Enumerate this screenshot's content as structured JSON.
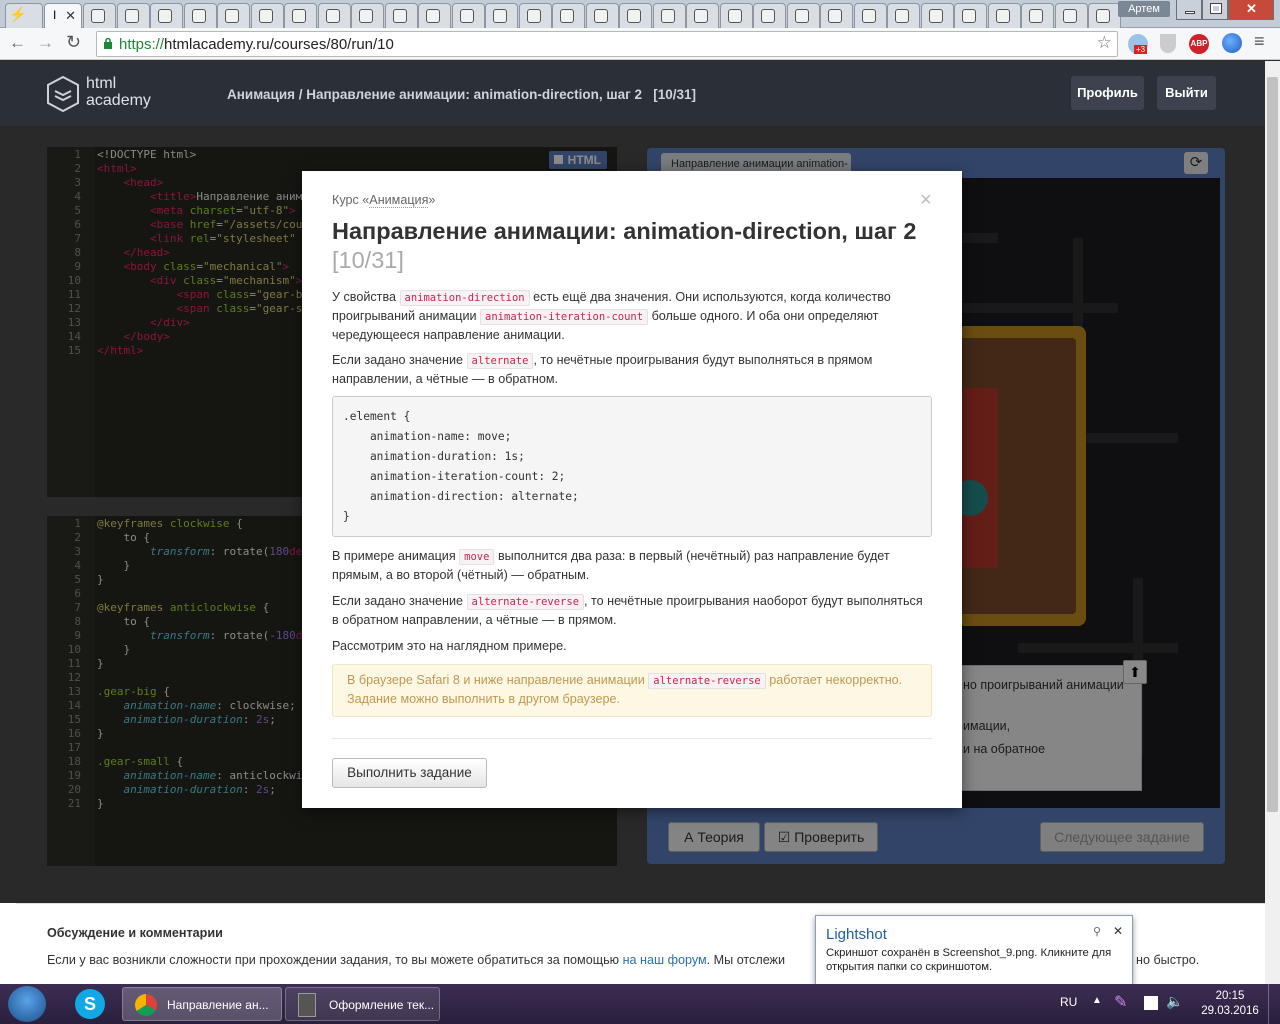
{
  "browser": {
    "tab_first_icon": "⚡",
    "tab_active_label": "I",
    "tab_close": "✕",
    "user_name": "Артем",
    "url_scheme": "https://",
    "url_rest": "htmlacademy.ru/courses/80/run/10",
    "abp": "ABP",
    "badge": "+3"
  },
  "header": {
    "logo_line1": "html",
    "logo_line2": "academy",
    "breadcrumb_course": "Анимация",
    "breadcrumb_sep": " / ",
    "breadcrumb_title": "Направление анимации: animation-direction, шаг 2",
    "breadcrumb_step": "[10/31]",
    "profile_button": "Профиль",
    "logout_button": "Выйти"
  },
  "html_editor": {
    "badge": "HTML",
    "line_numbers": [
      "1",
      "2",
      "3",
      "4",
      "5",
      "6",
      "7",
      "8",
      "9",
      "10",
      "11",
      "12",
      "13",
      "14",
      "15"
    ]
  },
  "css_editor": {
    "line_numbers": [
      "1",
      "2",
      "3",
      "4",
      "5",
      "6",
      "7",
      "8",
      "9",
      "10",
      "11",
      "12",
      "13",
      "14",
      "15",
      "16",
      "17",
      "18",
      "19",
      "20",
      "21"
    ]
  },
  "preview": {
    "tab_label": "Направление анимации animation-",
    "task_text_1": "но проигрываний анимации",
    "task_text_2": "имации,",
    "task_text_3": "и на обратное",
    "theory_button": "Теория",
    "check_button": "Проверить",
    "next_button": "Следующее задание"
  },
  "modal": {
    "course_prefix": "Курс «",
    "course_link": "Анимация",
    "course_suffix": "»",
    "close": "×",
    "title": "Направление анимации: animation-direction, шаг 2",
    "step": "[10/31]",
    "p1_a": "У свойства ",
    "p1_code1": "animation-direction",
    "p1_b": " есть ещё два значения. Они используются, когда количество проигрываний анимации ",
    "p1_code2": "animation-iteration-count",
    "p1_c": " больше одного. И оба они определяют чередующееся направление анимации.",
    "p2_a": "Если задано значение ",
    "p2_code": "alternate",
    "p2_b": ", то нечётные проигрывания будут выполняться в прямом направлении, а чётные — в обратном.",
    "code_block": ".element {\n    animation-name: move;\n    animation-duration: 1s;\n    animation-iteration-count: 2;\n    animation-direction: alternate;\n}",
    "p3_a": "В примере анимация ",
    "p3_code": "move",
    "p3_b": " выполнится два раза: в первый (нечётный) раз направление будет прямым, а во второй (чётный) — обратным.",
    "p4_a": "Если задано значение ",
    "p4_code": "alternate-reverse",
    "p4_b": ", то нечётные проигрывания наоборот будут выполняться в обратном направлении, а чётные — в прямом.",
    "p5": "Рассмотрим это на наглядном примере.",
    "warn_a": "В браузере Safari 8 и ниже направление анимации ",
    "warn_code": "alternate-reverse",
    "warn_b": " работает некорректно. Задание можно выполнить в другом браузере.",
    "run_button": "Выполнить задание"
  },
  "footer": {
    "heading": "Обсуждение и комментарии",
    "text_a": "Если у вас возникли сложности при прохождении задания, то вы можете обратиться за помощью ",
    "link": "на наш форум",
    "text_b": ". Мы отслежи",
    "text_c": "но быстро."
  },
  "lightshot": {
    "title": "Lightshot",
    "close": "✕",
    "text": "Скриншот сохранён в Screenshot_9.png. Кликните для открытия папки со скриншотом."
  },
  "taskbar": {
    "chrome_label": "Направление ан...",
    "other_label": "Оформление тек...",
    "lang": "RU",
    "time": "20:15",
    "date": "29.03.2016"
  }
}
